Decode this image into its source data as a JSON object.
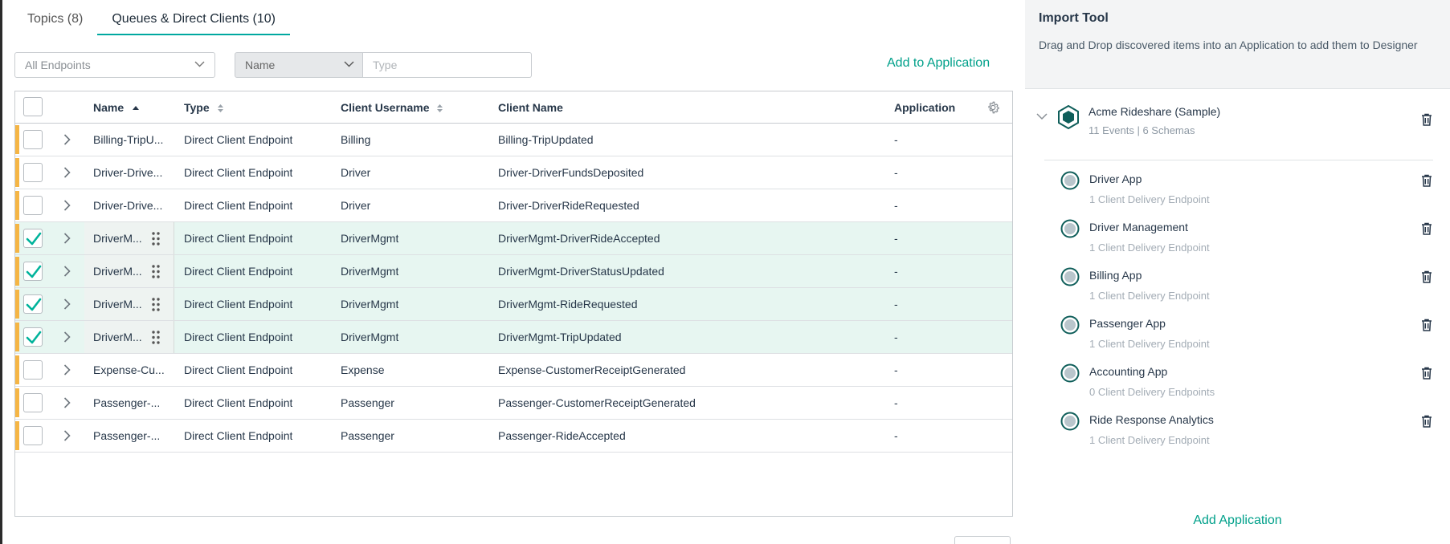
{
  "tabs": [
    {
      "label": "Topics (8)",
      "active": false
    },
    {
      "label": "Queues & Direct Clients (10)",
      "active": true
    }
  ],
  "toolbar": {
    "endpoint_filter": "All Endpoints",
    "search_field": "Name",
    "search_placeholder": "Type",
    "add_to_application": "Add to Application"
  },
  "table": {
    "headers": {
      "name": "Name",
      "type": "Type",
      "client_username": "Client Username",
      "client_name": "Client Name",
      "application": "Application"
    },
    "rows": [
      {
        "name": "Billing-TripU...",
        "type": "Direct Client Endpoint",
        "client_username": "Billing",
        "client_name": "Billing-TripUpdated",
        "application": "-",
        "checked": false
      },
      {
        "name": "Driver-Drive...",
        "type": "Direct Client Endpoint",
        "client_username": "Driver",
        "client_name": "Driver-DriverFundsDeposited",
        "application": "-",
        "checked": false
      },
      {
        "name": "Driver-Drive...",
        "type": "Direct Client Endpoint",
        "client_username": "Driver",
        "client_name": "Driver-DriverRideRequested",
        "application": "-",
        "checked": false
      },
      {
        "name": "DriverM...",
        "type": "Direct Client Endpoint",
        "client_username": "DriverMgmt",
        "client_name": "DriverMgmt-DriverRideAccepted",
        "application": "-",
        "checked": true
      },
      {
        "name": "DriverM...",
        "type": "Direct Client Endpoint",
        "client_username": "DriverMgmt",
        "client_name": "DriverMgmt-DriverStatusUpdated",
        "application": "-",
        "checked": true
      },
      {
        "name": "DriverM...",
        "type": "Direct Client Endpoint",
        "client_username": "DriverMgmt",
        "client_name": "DriverMgmt-RideRequested",
        "application": "-",
        "checked": true
      },
      {
        "name": "DriverM...",
        "type": "Direct Client Endpoint",
        "client_username": "DriverMgmt",
        "client_name": "DriverMgmt-TripUpdated",
        "application": "-",
        "checked": true
      },
      {
        "name": "Expense-Cu...",
        "type": "Direct Client Endpoint",
        "client_username": "Expense",
        "client_name": "Expense-CustomerReceiptGenerated",
        "application": "-",
        "checked": false
      },
      {
        "name": "Passenger-...",
        "type": "Direct Client Endpoint",
        "client_username": "Passenger",
        "client_name": "Passenger-CustomerReceiptGenerated",
        "application": "-",
        "checked": false
      },
      {
        "name": "Passenger-...",
        "type": "Direct Client Endpoint",
        "client_username": "Passenger",
        "client_name": "Passenger-RideAccepted",
        "application": "-",
        "checked": false
      }
    ]
  },
  "import_tool": {
    "title": "Import Tool",
    "description": "Drag and Drop discovered items into an Application to add them to Designer",
    "domain": {
      "name": "Acme Rideshare (Sample)",
      "meta": "11 Events | 6 Schemas"
    },
    "applications": [
      {
        "name": "Driver App",
        "sub": "1 Client Delivery Endpoint"
      },
      {
        "name": "Driver Management",
        "sub": "1 Client Delivery Endpoint"
      },
      {
        "name": "Billing App",
        "sub": "1 Client Delivery Endpoint"
      },
      {
        "name": "Passenger App",
        "sub": "1 Client Delivery Endpoint"
      },
      {
        "name": "Accounting App",
        "sub": "0 Client Delivery Endpoints"
      },
      {
        "name": "Ride Response Analytics",
        "sub": "1 Client Delivery Endpoint"
      }
    ],
    "add_application": "Add Application"
  },
  "colors": {
    "accent": "#00a08a",
    "tab_underline": "#00a8a0",
    "row_marker": "#f5b544",
    "selected_row": "#e7f6f1",
    "domain_icon": "#0f5e5a"
  }
}
